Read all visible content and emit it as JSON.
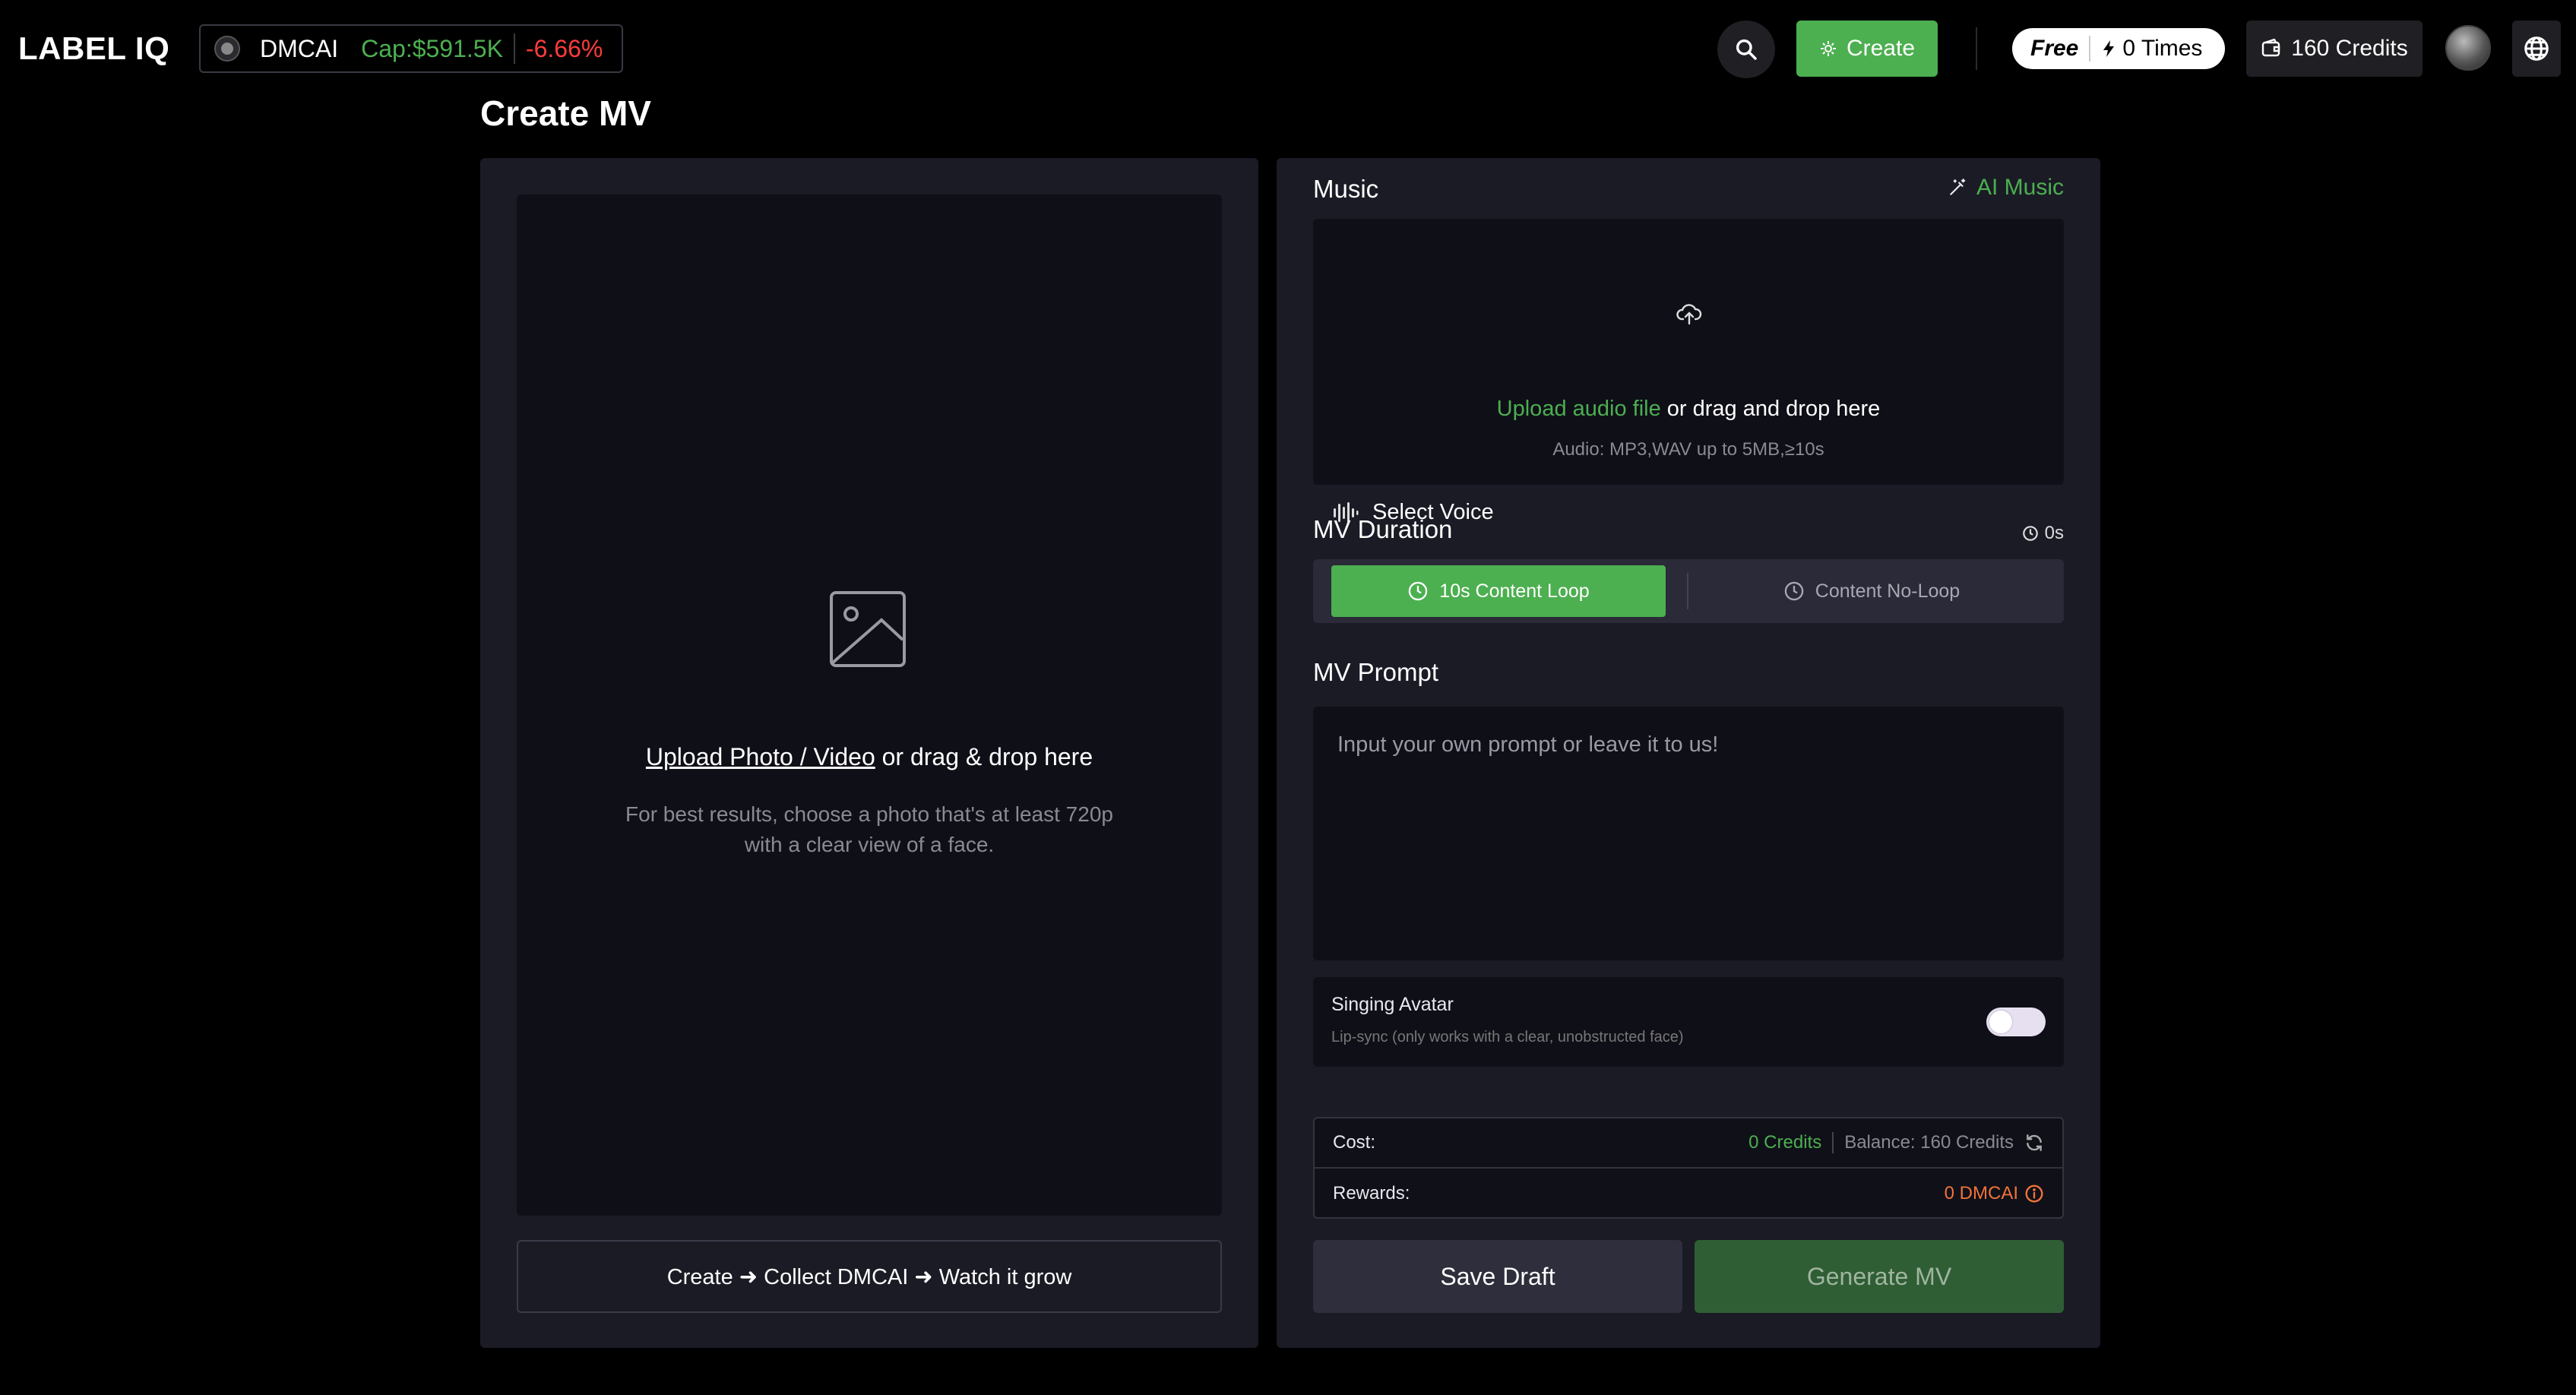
{
  "header": {
    "brand": "LABEL IQ",
    "ticker": {
      "symbol": "DMCAI",
      "cap": "Cap:$591.5K",
      "change": "-6.66%"
    },
    "create_label": "Create",
    "plan": {
      "name": "Free",
      "times": "0 Times"
    },
    "credits": "160 Credits"
  },
  "page": {
    "title": "Create MV"
  },
  "upload": {
    "link_text": "Upload Photo / Video",
    "rest_text": " or drag & drop here",
    "hint_line1": "For best results, choose a photo that's at least 720p",
    "hint_line2": "with a clear view of a face.",
    "tagline": "Create ➜ Collect DMCAI ➜ Watch it grow"
  },
  "music": {
    "title": "Music",
    "ai_music": "AI Music",
    "upload_link": "Upload audio file",
    "upload_rest": " or drag and drop here",
    "hint": "Audio: MP3,WAV up to 5MB,≥10s",
    "select_voice": "Select Voice"
  },
  "duration": {
    "title": "MV Duration",
    "value": "0s",
    "options": [
      {
        "label": "10s Content Loop",
        "active": true
      },
      {
        "label": "Content No-Loop",
        "active": false
      }
    ]
  },
  "prompt": {
    "title": "MV Prompt",
    "placeholder": "Input your own prompt or leave it to us!"
  },
  "singing": {
    "title": "Singing Avatar",
    "subtitle": "Lip-sync (only works with a clear, unobstructed face)",
    "enabled": false
  },
  "cost": {
    "cost_label": "Cost:",
    "cost_value": "0 Credits",
    "balance": "Balance: 160 Credits",
    "rewards_label": "Rewards:",
    "rewards_value": "0 DMCAI"
  },
  "actions": {
    "save": "Save Draft",
    "generate": "Generate MV"
  },
  "colors": {
    "accent": "#4caf50",
    "negative": "#ff3b3b",
    "reward": "#f0733a",
    "panel": "#1b1b26",
    "inset": "#0f0f18"
  }
}
